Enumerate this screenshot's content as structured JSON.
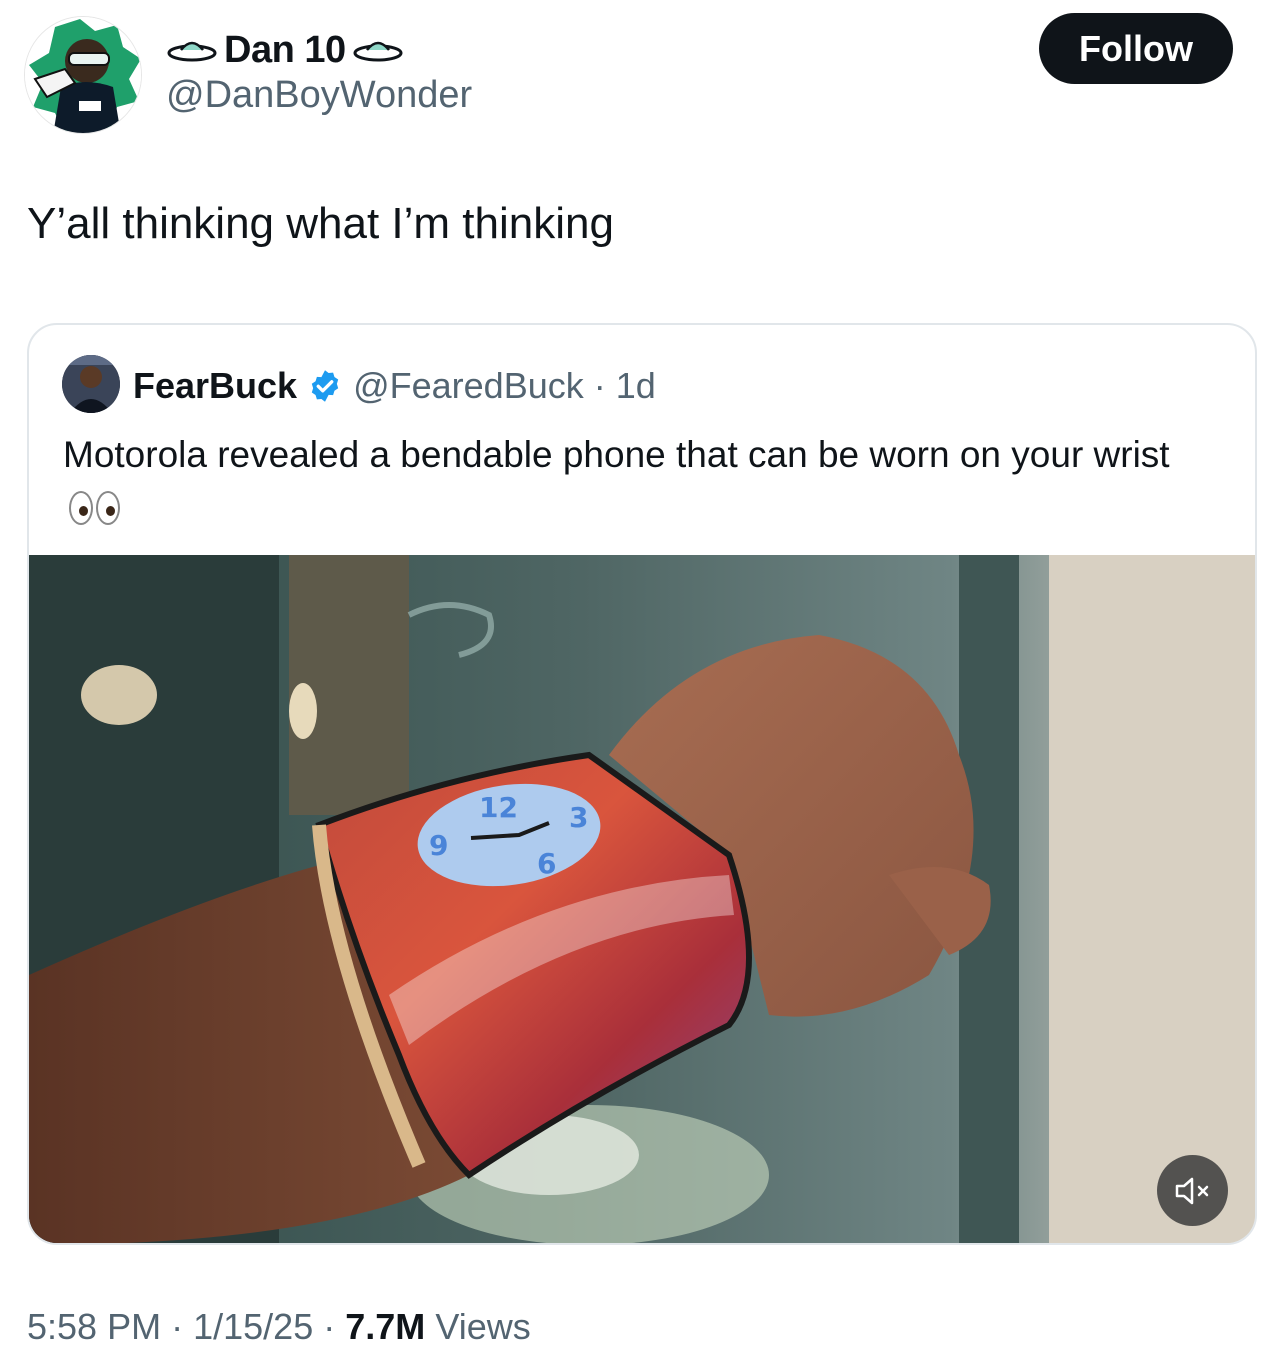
{
  "author": {
    "display_name": "Dan 10",
    "handle": "@DanBoyWonder",
    "avatar_icon": "cartoon-character-avatar",
    "name_decoration_icon": "ufo-icon"
  },
  "follow_button": {
    "label": "Follow"
  },
  "tweet": {
    "text": "Y’all thinking what I’m thinking"
  },
  "quoted_tweet": {
    "display_name": "FearBuck",
    "verified": true,
    "handle": "@FearedBuck",
    "separator": "·",
    "time_ago": "1d",
    "text": "Motorola revealed a bendable phone that can be worn on your wrist",
    "emoji": "eyes-emoji",
    "media": {
      "type": "video",
      "description_icon": "wrist-bendable-phone-photo",
      "clock_numbers": [
        "12",
        "3",
        "6",
        "9"
      ],
      "mute_icon": "muted-speaker-icon"
    }
  },
  "footer": {
    "time": "5:58 PM",
    "sep1": "·",
    "date": "1/15/25",
    "sep2": "·",
    "views_count": "7.7M",
    "views_label": "Views"
  },
  "colors": {
    "text_primary": "#0f1419",
    "text_secondary": "#536471",
    "follow_bg": "#0f1419",
    "verified_blue": "#1d9bf0",
    "card_border": "#e1e6ea"
  }
}
